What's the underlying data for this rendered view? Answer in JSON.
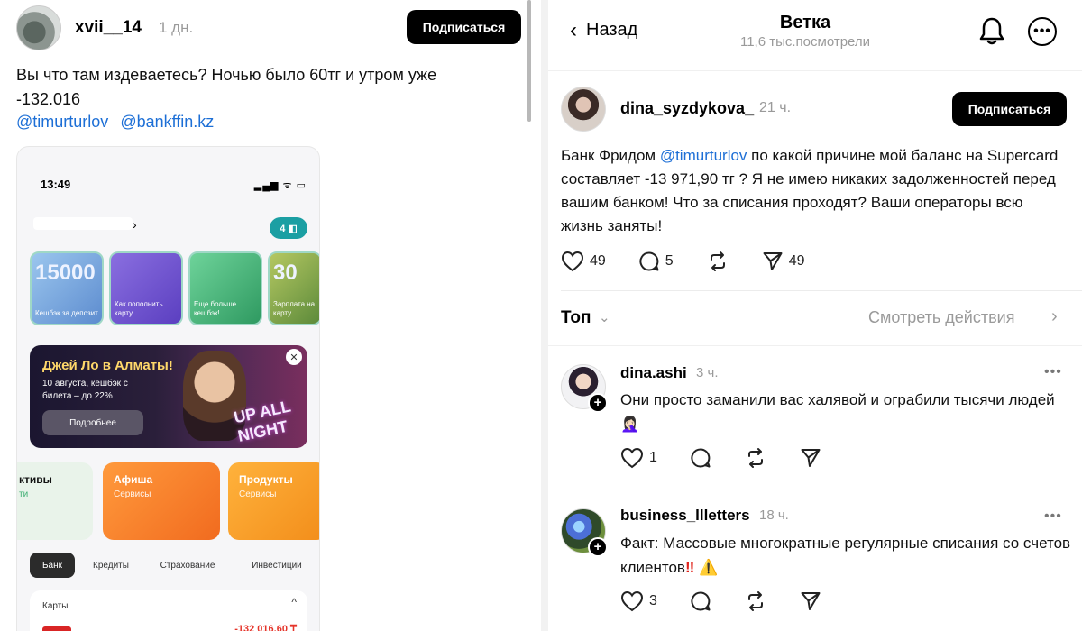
{
  "left_post": {
    "username": "xvii__14",
    "time": "1 дн.",
    "subscribe_label": "Подписаться",
    "text": "Вы что там издеваетесь? Ночью было 60тг и утром уже -132.016",
    "mentions": [
      "@timurturlov",
      "@bankffin.kz"
    ]
  },
  "phone_screenshot": {
    "time": "13:49",
    "status": "▂▄▆ ᯤ ▭",
    "chevron": "›",
    "badge": "4 ◧",
    "stories": [
      {
        "big": "15000",
        "label": "Кешбэк за депозит"
      },
      {
        "big": "",
        "label": "Как пополнить карту"
      },
      {
        "big": "",
        "label": "Еще больше кешбэк!"
      },
      {
        "big": "30",
        "label": "Зарплата на карту"
      }
    ],
    "banner": {
      "title": "Джей Ло в Алматы!",
      "subtitle": "10 августа, кешбэк с билета – до 22%",
      "button": "Подробнее",
      "close": "✕",
      "logo": "UP ALL NIGHT"
    },
    "tiles": [
      {
        "title": "ктивы",
        "sub": "ти"
      },
      {
        "title": "Афиша",
        "sub": "Сервисы"
      },
      {
        "title": "Продукты",
        "sub": "Сервисы"
      }
    ],
    "tabs": [
      "Банк",
      "Кредиты",
      "Страхование",
      "Инвестиции"
    ],
    "cards_title": "Карты",
    "cards_chevron": "^",
    "cards_amount": "-132 016,60 ₸"
  },
  "right_header": {
    "back_label": "Назад",
    "back_arrow": "‹",
    "title": "Ветка",
    "views": "11,6 тыс.посмотрели",
    "bell_icon": "bell-icon",
    "more_icon": "more-icon",
    "more_glyph": "•••"
  },
  "main_post": {
    "username": "dina_syzdykova_",
    "time": "21 ч.",
    "subscribe_label": "Подписаться",
    "text_before": "Банк Фридом ",
    "mention": "@timurturlov",
    "text_after": " по какой причине мой баланс на Supercard составляет -13 971,90 тг ?  Я не имею никаких задолженностей перед вашим банком! Что за списания проходят? Ваши операторы всю жизнь заняты!",
    "likes": "49",
    "comments": "5",
    "shares": "49"
  },
  "sort_bar": {
    "label": "Топ",
    "label_chevron": "⌄",
    "see_actions": "Смотреть действия",
    "see_actions_chevron": "›"
  },
  "comments": [
    {
      "username": "dina.ashi",
      "time": "3 ч.",
      "more": "•••",
      "text": "Они просто заманили вас халявой и ограбили тысячи людей 🤦🏻‍♀️",
      "likes": "1",
      "plus": "+"
    },
    {
      "username": "business_llletters",
      "time": "18 ч.",
      "more": "•••",
      "text": "Факт: Массовые многократные регулярные списания со счетов клиентов",
      "emoji_red": "‼",
      "emoji_warn": "⚠️",
      "likes": "3",
      "plus": "+"
    }
  ],
  "colors": {
    "mention": "#1d6fd6",
    "muted": "#9a9a9a",
    "button_bg": "#000000",
    "negative_amount": "#e5342a"
  }
}
